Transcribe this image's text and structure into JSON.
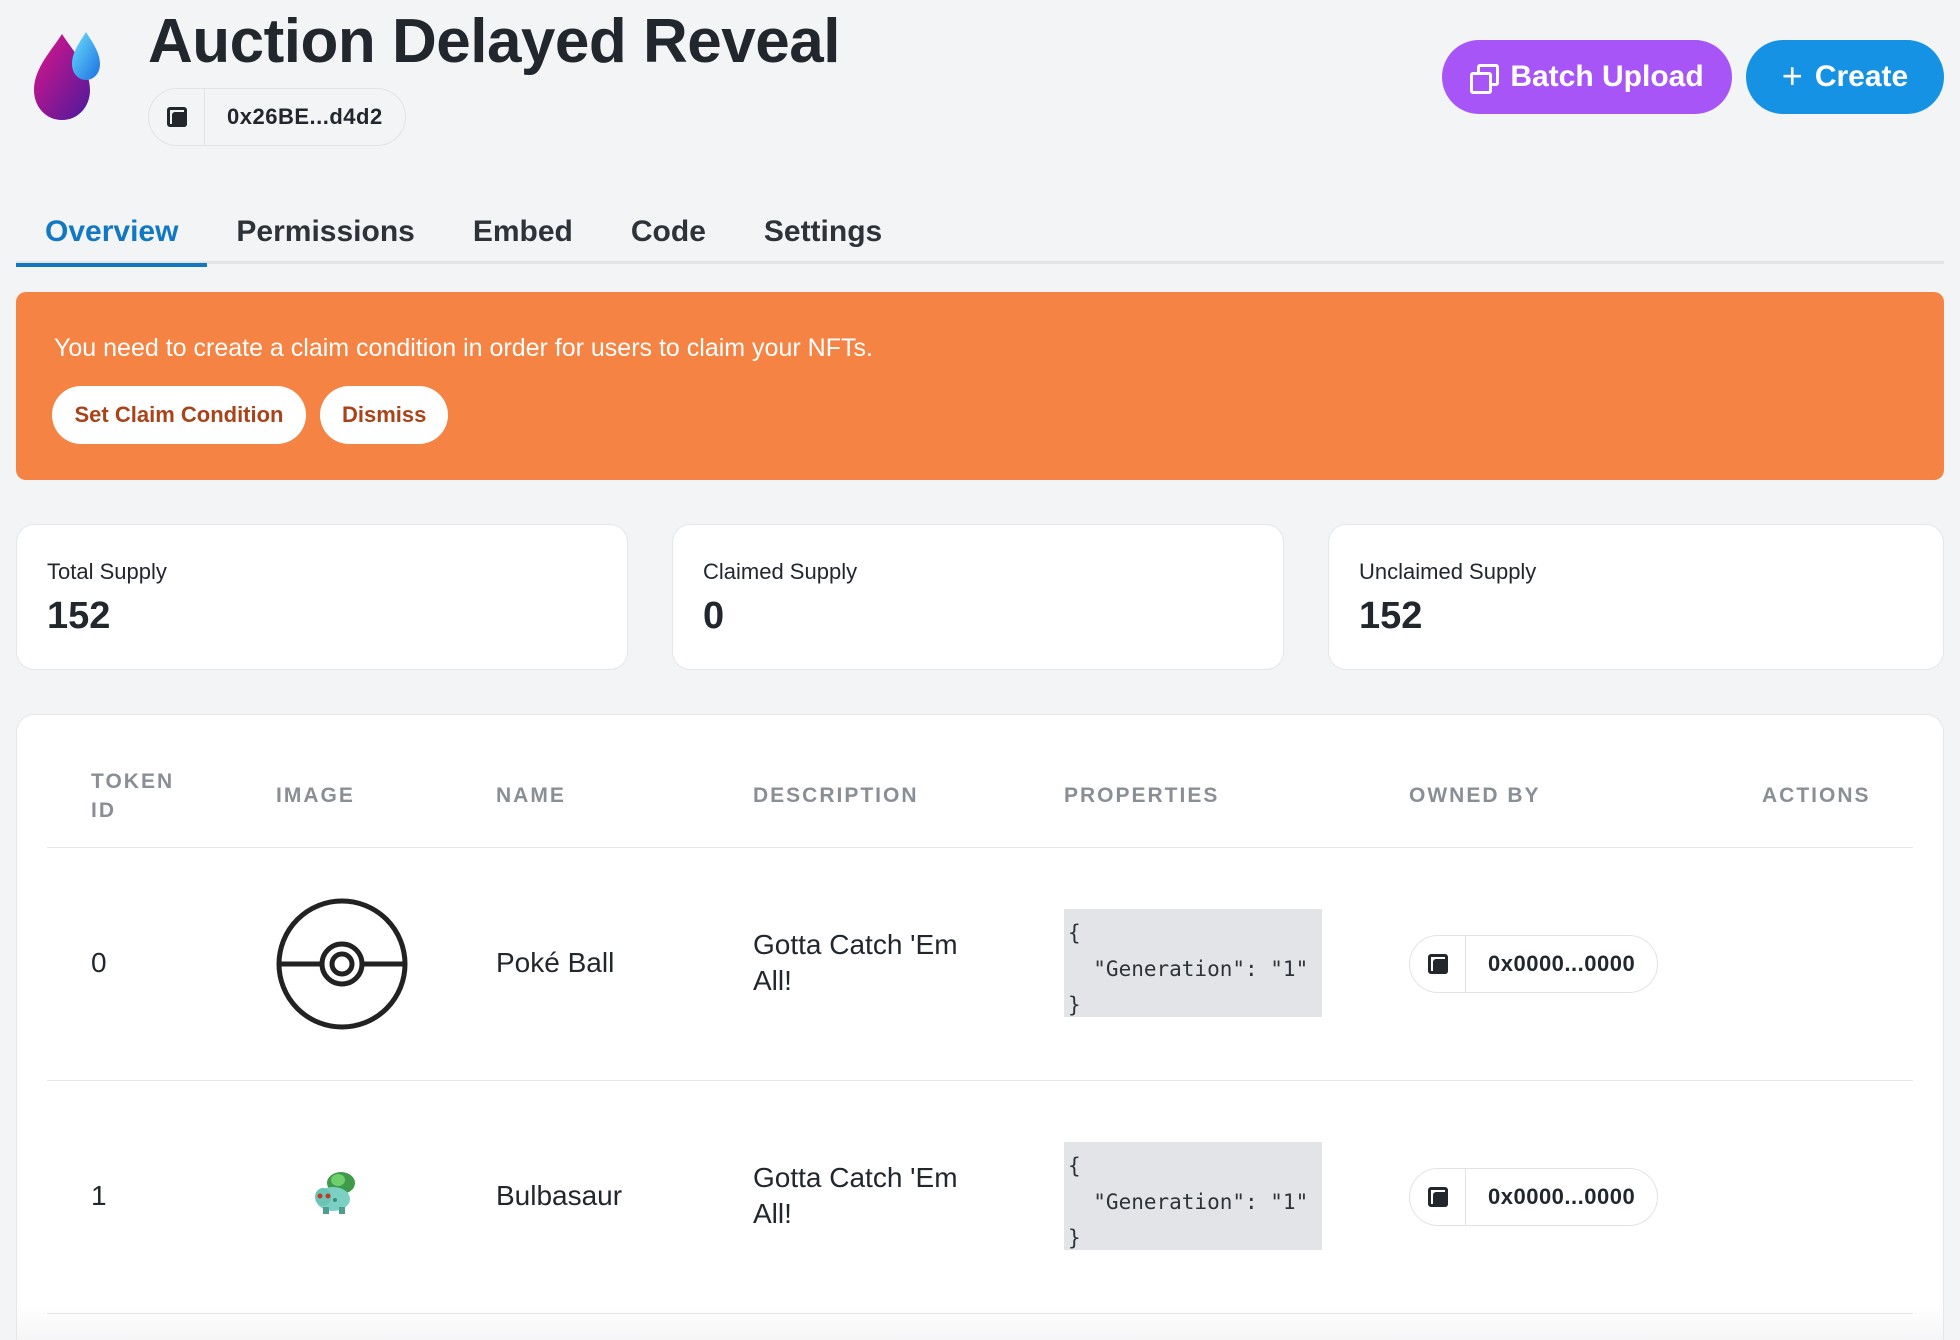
{
  "header": {
    "title": "Auction Delayed Reveal",
    "contract_address": "0x26BE...d4d2",
    "batch_upload_label": "Batch Upload",
    "create_label": "Create"
  },
  "tabs": [
    {
      "label": "Overview",
      "active": true
    },
    {
      "label": "Permissions"
    },
    {
      "label": "Embed"
    },
    {
      "label": "Code"
    },
    {
      "label": "Settings"
    }
  ],
  "alert": {
    "message": "You need to create a claim condition in order for users to claim your NFTs.",
    "set_claim_label": "Set Claim Condition",
    "dismiss_label": "Dismiss",
    "color": "#f58444"
  },
  "stats": [
    {
      "label": "Total Supply",
      "value": "152"
    },
    {
      "label": "Claimed Supply",
      "value": "0"
    },
    {
      "label": "Unclaimed Supply",
      "value": "152"
    }
  ],
  "table": {
    "headers": {
      "token_id_1": "TOKEN",
      "token_id_2": "ID",
      "image": "IMAGE",
      "name": "NAME",
      "description": "DESCRIPTION",
      "properties": "PROPERTIES",
      "owned_by": "OWNED BY",
      "actions": "ACTIONS"
    },
    "rows": [
      {
        "token_id": "0",
        "image": "poke-ball-icon",
        "name": "Poké Ball",
        "description_1": "Gotta Catch 'Em",
        "description_2": "All!",
        "properties": "{\n  \"Generation\": \"1\"\n}",
        "owned_by": "0x0000...0000"
      },
      {
        "token_id": "1",
        "image": "bulbasaur-sprite",
        "name": "Bulbasaur",
        "description_1": "Gotta Catch 'Em",
        "description_2": "All!",
        "properties": "{\n  \"Generation\": \"1\"\n}",
        "owned_by": "0x0000...0000"
      }
    ]
  },
  "colors": {
    "batch_upload": "#a855f7",
    "create": "#1592e3",
    "active_tab": "#1378c4"
  }
}
